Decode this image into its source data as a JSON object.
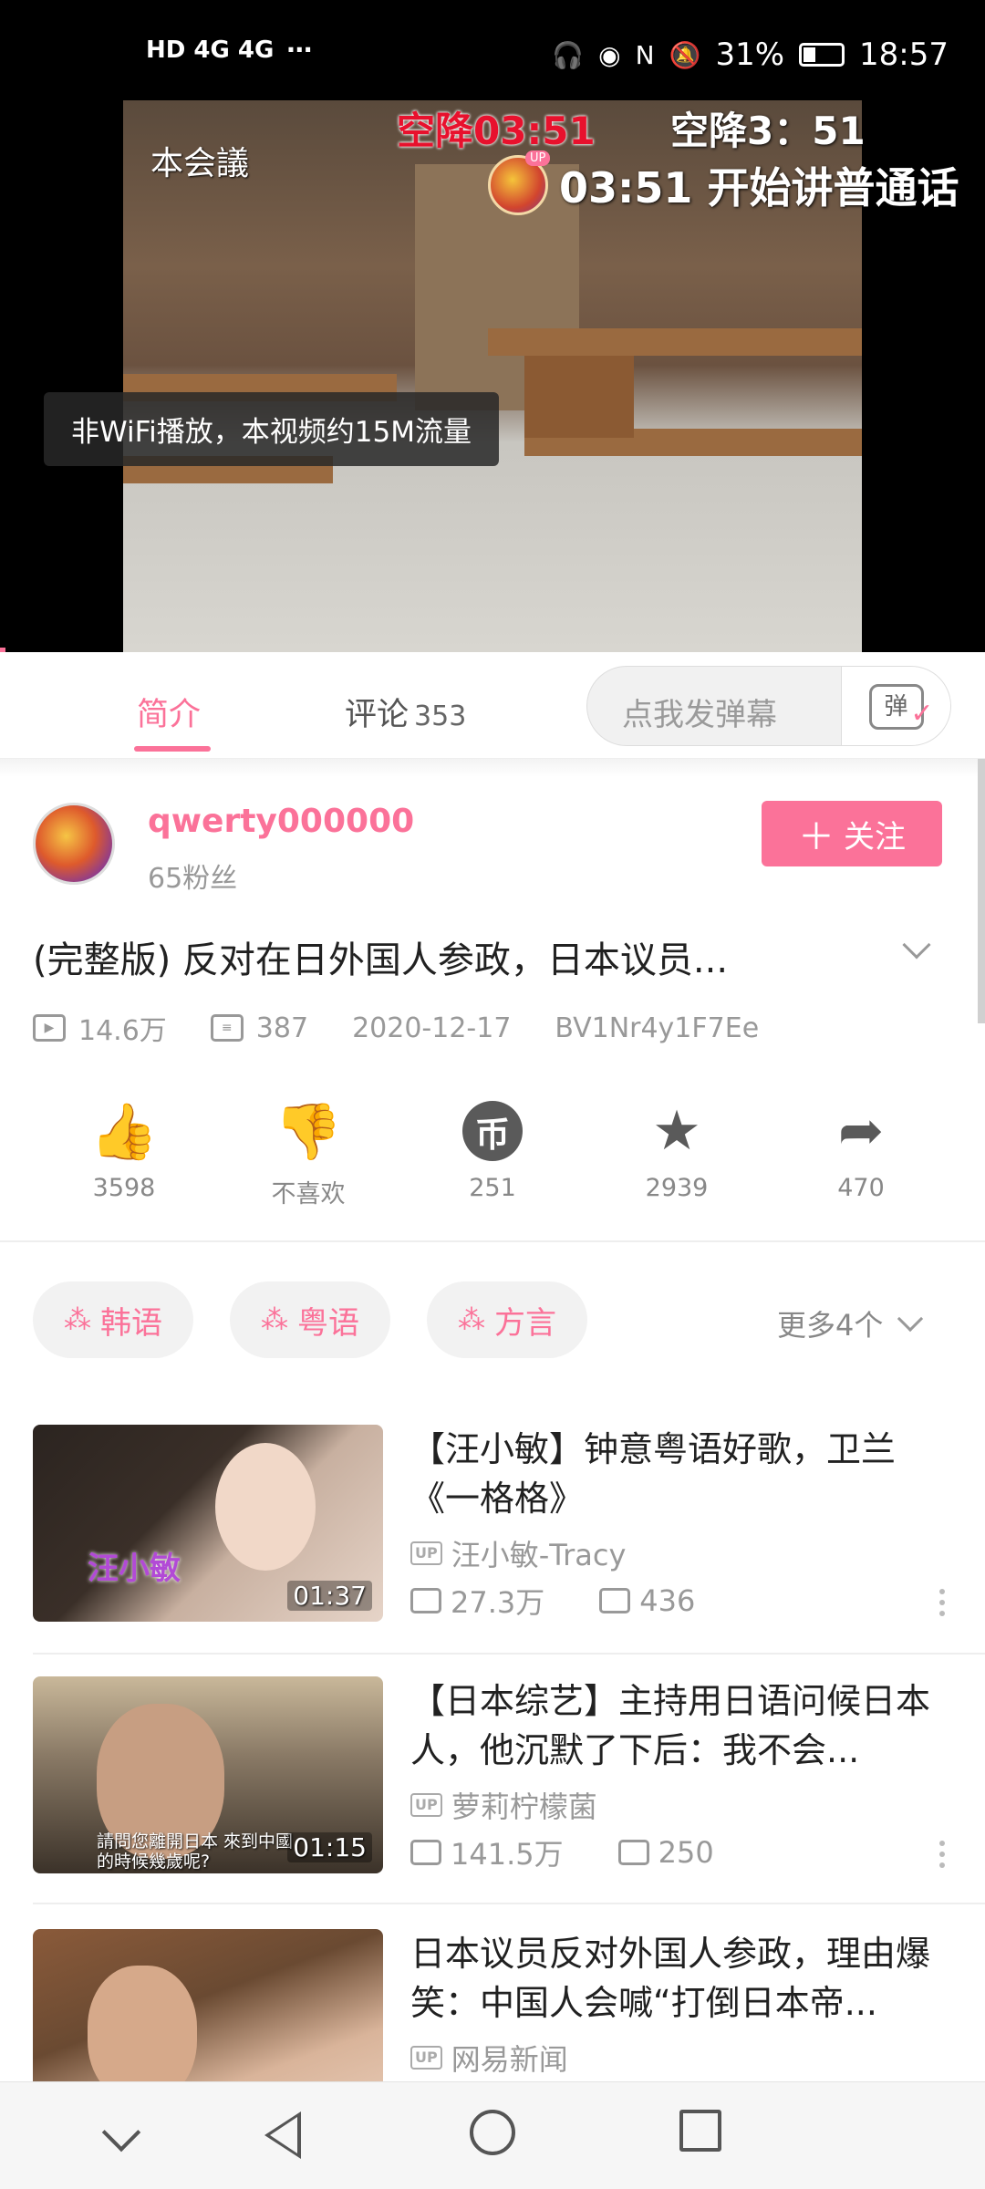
{
  "status_bar": {
    "network_left": "HD 4G 4G",
    "battery": "31%",
    "time": "18:57"
  },
  "video": {
    "room_label": "本会議",
    "danmaku_red": "空降03:51",
    "danmaku_white": "空降3：51",
    "danmaku_up_badge": "UP",
    "danmaku_up_text": "03:51 开始讲普通话",
    "toast": "非WiFi播放，本视频约15M流量"
  },
  "tabs": {
    "intro": "简介",
    "comments": "评论",
    "comments_count": "353",
    "danmaku_placeholder": "点我发弹幕",
    "danmaku_button": "弹"
  },
  "uploader": {
    "name": "qwerty000000",
    "fans": "65粉丝",
    "follow_label": "关注"
  },
  "video_info": {
    "title": "(完整版) 反对在日外国人参政，日本议员...",
    "views": "14.6万",
    "danmaku_count": "387",
    "date": "2020-12-17",
    "bvid": "BV1Nr4y1F7Ee"
  },
  "actions": [
    {
      "name": "like",
      "label": "3598"
    },
    {
      "name": "dislike",
      "label": "不喜欢"
    },
    {
      "name": "coin",
      "label": "251"
    },
    {
      "name": "favorite",
      "label": "2939"
    },
    {
      "name": "share",
      "label": "470"
    }
  ],
  "tags": {
    "items": [
      "韩语",
      "粤语",
      "方言"
    ],
    "more": "更多4个"
  },
  "recommendations": [
    {
      "title": "【汪小敏】钟意粤语好歌，卫兰《一格格》",
      "up": "汪小敏-Tracy",
      "views": "27.3万",
      "danmaku": "436",
      "duration": "01:37",
      "thumb_caption": "汪小敏"
    },
    {
      "title": "【日本综艺】主持用日语问候日本人，他沉默了下后：我不会...",
      "up": "萝莉柠檬菌",
      "views": "141.5万",
      "danmaku": "250",
      "duration": "01:15",
      "thumb_caption": "請問您離開日本 來到中國的時候幾歲呢?"
    },
    {
      "title": "日本议员反对外国人参政，理由爆笑：中国人会喊“打倒日本帝...",
      "up": "网易新闻"
    }
  ],
  "up_tag": "UP",
  "colors": {
    "accent": "#fb7299"
  }
}
